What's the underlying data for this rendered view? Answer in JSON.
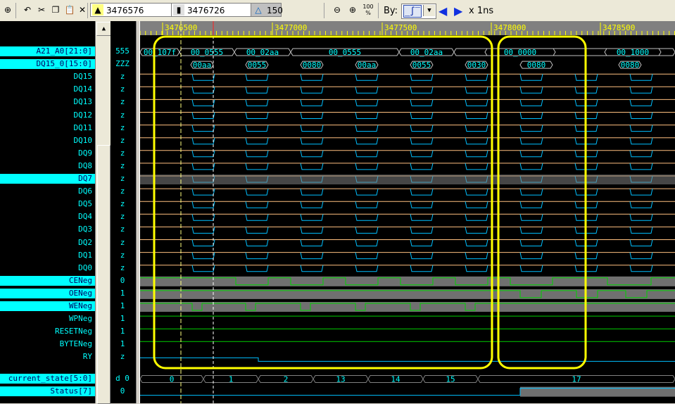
{
  "toolbar": {
    "icons": [
      "new-file-icon",
      "undo-icon",
      "cut-icon",
      "copy-icon",
      "paste-icon",
      "pointer-icon"
    ],
    "cursor1": {
      "icon": "pointer-icon",
      "value": "3476576"
    },
    "cursor2": {
      "icon": "marker-icon",
      "value": "3476726"
    },
    "delta": {
      "icon": "delta-icon",
      "value": "150"
    },
    "zoom_out_icon": "zoom-out-icon",
    "zoom_in_icon": "zoom-in-icon",
    "zoom_full_icon": "zoom-100-icon",
    "by_label": "By:",
    "by_value_icon": "rising-edge-icon",
    "prev_icon": "arrow-left-icon",
    "next_icon": "arrow-right-icon",
    "scale_label": "x 1ns"
  },
  "timeline": {
    "ticks": [
      "3476500",
      "3477000",
      "3477500",
      "3478000",
      "3478500"
    ]
  },
  "signals": [
    {
      "name": "A21_A0[21:0]",
      "value": "555",
      "kind": "bus",
      "selected": true
    },
    {
      "name": "DQ15_0[15:0]",
      "value": "ZZZ",
      "kind": "bus",
      "selected": true
    },
    {
      "name": "DQ15",
      "value": "z",
      "kind": "dq"
    },
    {
      "name": "DQ14",
      "value": "z",
      "kind": "dq"
    },
    {
      "name": "DQ13",
      "value": "z",
      "kind": "dq"
    },
    {
      "name": "DQ12",
      "value": "z",
      "kind": "dq"
    },
    {
      "name": "DQ11",
      "value": "z",
      "kind": "dq"
    },
    {
      "name": "DQ10",
      "value": "z",
      "kind": "dq"
    },
    {
      "name": "DQ9",
      "value": "z",
      "kind": "dq"
    },
    {
      "name": "DQ8",
      "value": "z",
      "kind": "dq"
    },
    {
      "name": "DQ7",
      "value": "z",
      "kind": "dq",
      "selected": true
    },
    {
      "name": "DQ6",
      "value": "z",
      "kind": "dq"
    },
    {
      "name": "DQ5",
      "value": "z",
      "kind": "dq"
    },
    {
      "name": "DQ4",
      "value": "z",
      "kind": "dq"
    },
    {
      "name": "DQ3",
      "value": "z",
      "kind": "dq"
    },
    {
      "name": "DQ2",
      "value": "z",
      "kind": "dq"
    },
    {
      "name": "DQ1",
      "value": "z",
      "kind": "dq"
    },
    {
      "name": "DQ0",
      "value": "z",
      "kind": "dq"
    },
    {
      "name": "CENeg",
      "value": "0",
      "kind": "ctl",
      "selected": true
    },
    {
      "name": "OENeg",
      "value": "1",
      "kind": "ctl",
      "selected": true
    },
    {
      "name": "WENeg",
      "value": "1",
      "kind": "ctl",
      "selected": true
    },
    {
      "name": "WPNeg",
      "value": "1",
      "kind": "flat"
    },
    {
      "name": "RESETNeg",
      "value": "1",
      "kind": "flat"
    },
    {
      "name": "BYTENeg",
      "value": "1",
      "kind": "flat"
    },
    {
      "name": "RY",
      "value": "z",
      "kind": "ry"
    },
    {
      "name": "current_state[5:0]",
      "value": "d 0",
      "kind": "state",
      "selected": true
    },
    {
      "name": "Status[7]",
      "value": "0",
      "kind": "status",
      "selected": true
    }
  ],
  "bus_labels": {
    "addr": [
      "00_107f",
      "00_0555",
      "00_02aa",
      "00_0555",
      "00_02aa",
      "00_0000",
      "00_1000"
    ],
    "data": [
      "00aa",
      "0055",
      "0080",
      "00aa",
      "0055",
      "0030",
      "0080",
      "0080"
    ],
    "state": [
      "0",
      "1",
      "2",
      "13",
      "14",
      "15",
      "17"
    ]
  },
  "colors": {
    "accent": "#00ffff",
    "highlight": "#ffff00",
    "wave_green": "#00d000",
    "wave_orange": "#ffc080",
    "wave_blue": "#00c0ff"
  }
}
